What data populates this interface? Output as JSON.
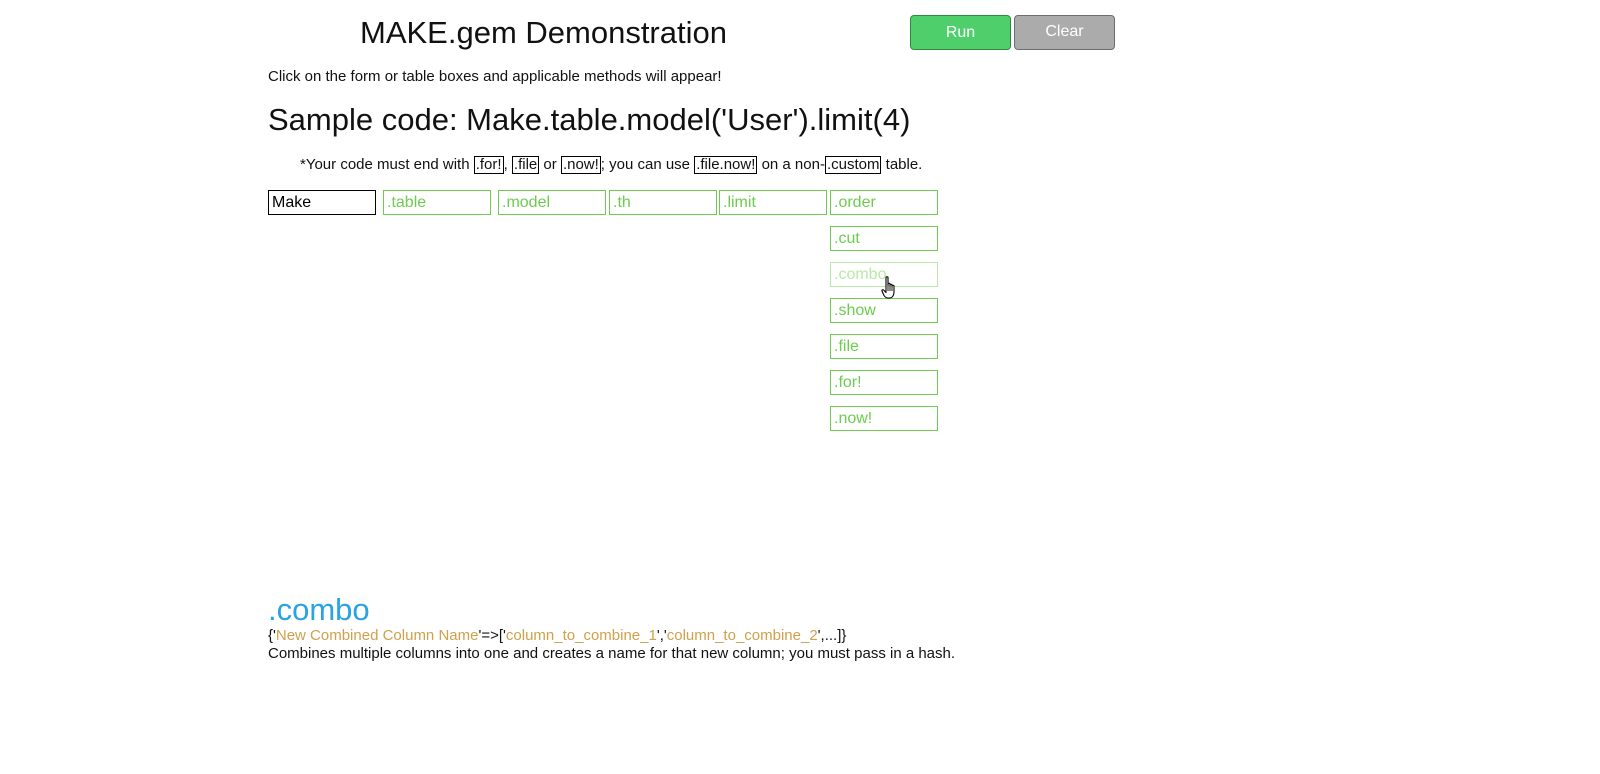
{
  "header": {
    "title": "MAKE.gem Demonstration",
    "run_label": "Run",
    "clear_label": "Clear"
  },
  "intro_text": "Click on the form or table boxes and applicable methods will appear!",
  "sample_code": "Sample code: Make.table.model('User').limit(4)",
  "note": {
    "prefix": "*Your code must end with ",
    "code1": ".for!",
    "sep1": ", ",
    "code2": ".file",
    "sep2": " or ",
    "code3": ".now!",
    "sep3": "; you can use ",
    "code4": ".file.now!",
    "sep4": " on a non-",
    "code5": ".custom",
    "suffix": " table."
  },
  "chain": {
    "make": "Make",
    "table": ".table",
    "model": ".model",
    "th": ".th",
    "limit": ".limit"
  },
  "methods": [
    ".order",
    ".cut",
    ".combo",
    ".show",
    ".file",
    ".for!",
    ".now!"
  ],
  "active_method": {
    "name": ".combo",
    "sig": {
      "open": "{'",
      "arg1": "New Combined Column Name",
      "mid": "'=>['",
      "arg2": "column_to_combine_1",
      "sep": "','",
      "arg3": "column_to_combine_2",
      "close": "',...]}"
    },
    "description": "Combines multiple columns into one and creates a name for that new column; you must pass in a hash."
  },
  "colors": {
    "run_button": "#4ecf6b",
    "clear_button": "#ababab",
    "method_green": "#6dcc4f",
    "method_title_blue": "#29a3e1",
    "argument_gold": "#d0a04a"
  }
}
